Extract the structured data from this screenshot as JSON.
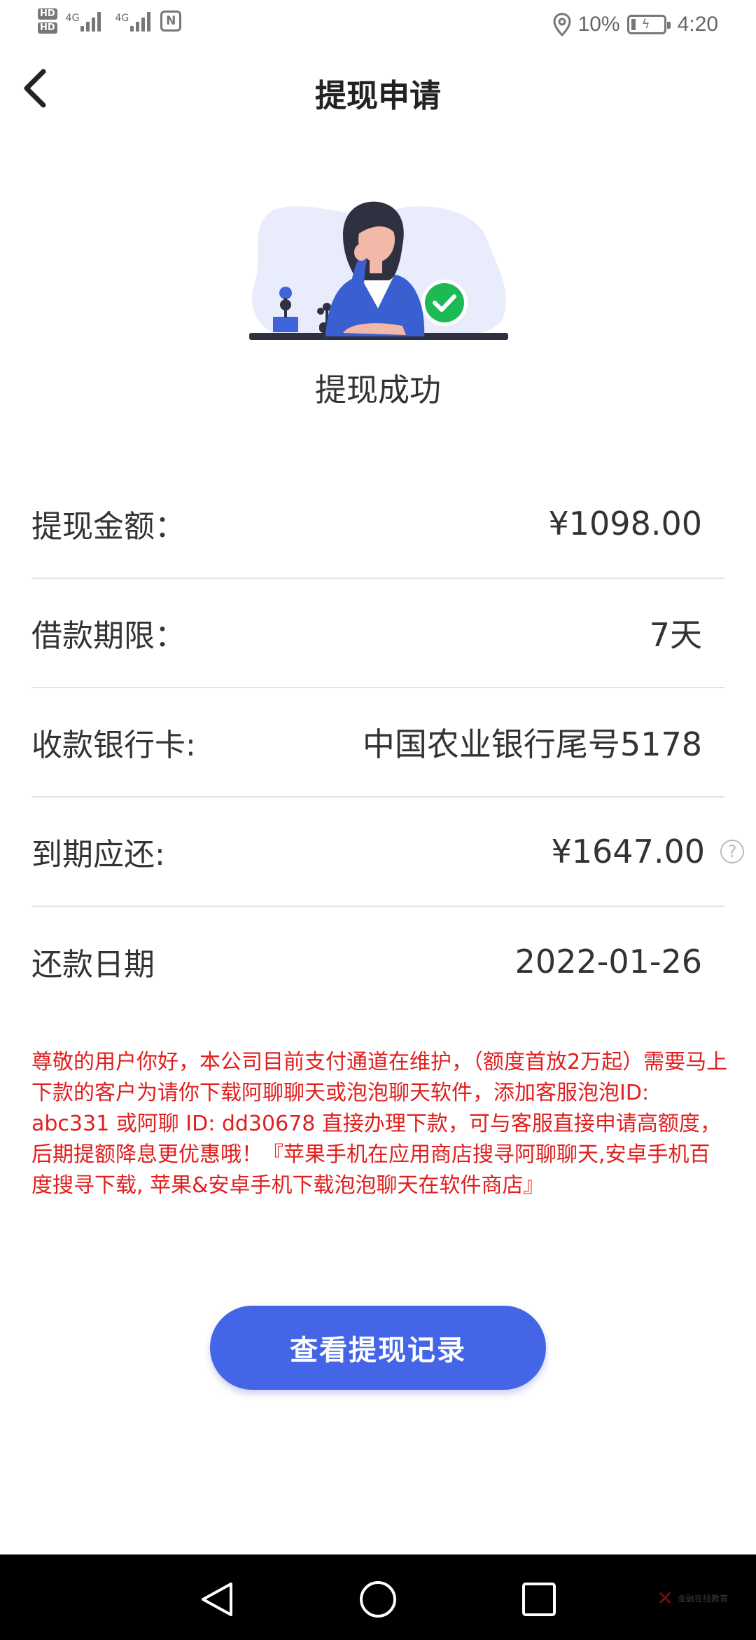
{
  "status_bar": {
    "hd1": "HD",
    "hd2": "HD",
    "net1": "4G",
    "net2": "4G",
    "nfc": "N",
    "battery_percent": "10%",
    "time": "4:20"
  },
  "header": {
    "title": "提现申请"
  },
  "result": {
    "text": "提现成功"
  },
  "details": [
    {
      "label": "提现金额：",
      "value": "¥1098.00"
    },
    {
      "label": "借款期限：",
      "value": "7天"
    },
    {
      "label": "收款银行卡:",
      "value": "中国农业银行尾号5178"
    },
    {
      "label": "到期应还:",
      "value": "¥1647.00"
    },
    {
      "label": "还款日期",
      "value": "2022-01-26"
    }
  ],
  "notice": "尊敬的用户你好，本公司目前支付通道在维护，（额度首放2万起）需要马上下款的客户为请你下载阿聊聊天或泡泡聊天软件，添加客服泡泡ID: abc331 或阿聊 ID: dd30678 直接办理下款，可与客服直接申请高额度，后期提额降息更优惠哦！『苹果手机在应用商店搜寻阿聊聊天,安卓手机百度搜寻下载, 苹果&安卓手机下载泡泡聊天在软件商店』",
  "button": {
    "label": "查看提现记录"
  },
  "watermark": {
    "text": "金融在线教育"
  },
  "colors": {
    "primary": "#4466e6",
    "notice": "#e0201f",
    "success": "#1db954",
    "divider": "#e2e2e2"
  },
  "icons": [
    "back-arrow-icon",
    "success-check-icon",
    "help-icon",
    "nav-back-icon",
    "nav-home-icon",
    "nav-recents-icon"
  ]
}
